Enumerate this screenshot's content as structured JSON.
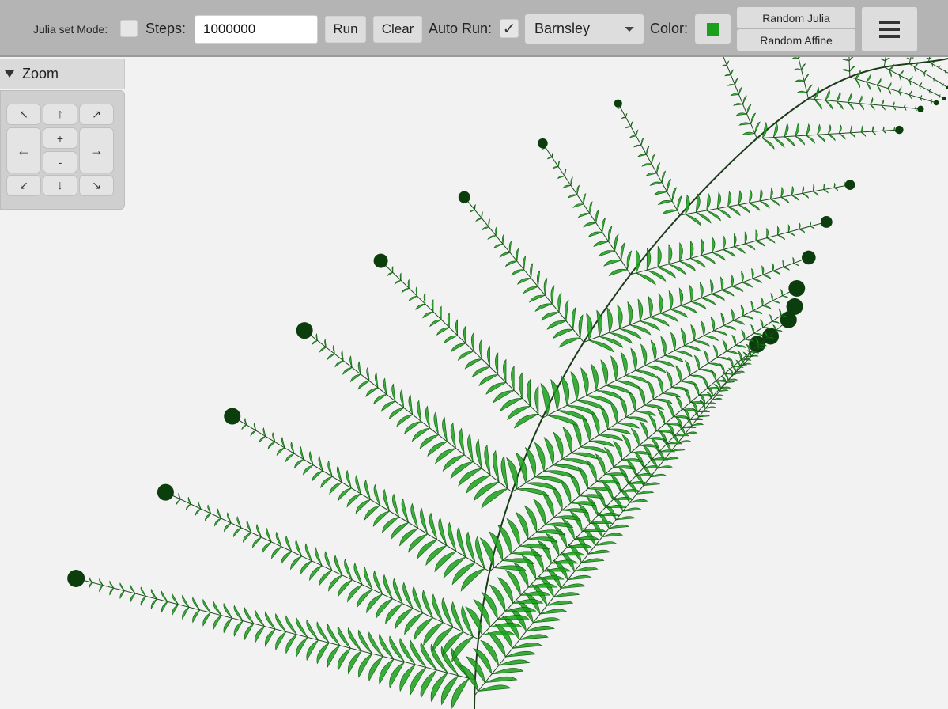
{
  "toolbar": {
    "julia_mode_label": "Julia set Mode:",
    "steps_label": "Steps:",
    "steps_value": "1000000",
    "run_label": "Run",
    "clear_label": "Clear",
    "auto_run_label": "Auto Run:",
    "auto_run_check_glyph": "✓",
    "fractal_select_value": "Barnsley",
    "color_label": "Color:",
    "color_value": "#1aa01a",
    "random_julia_label": "Random Julia",
    "random_affine_label": "Random Affine",
    "menu_icon": "hamburger-icon"
  },
  "zoom": {
    "header_label": "Zoom",
    "buttons": {
      "up_left": "↖",
      "up": "↑",
      "up_right": "↗",
      "left": "←",
      "zoom_in": "+",
      "zoom_out": "-",
      "right": "→",
      "down_left": "↙",
      "down": "↓",
      "down_right": "↘"
    }
  },
  "canvas": {
    "background": "#f2f2f2",
    "fern_color": "#1aa01a"
  }
}
